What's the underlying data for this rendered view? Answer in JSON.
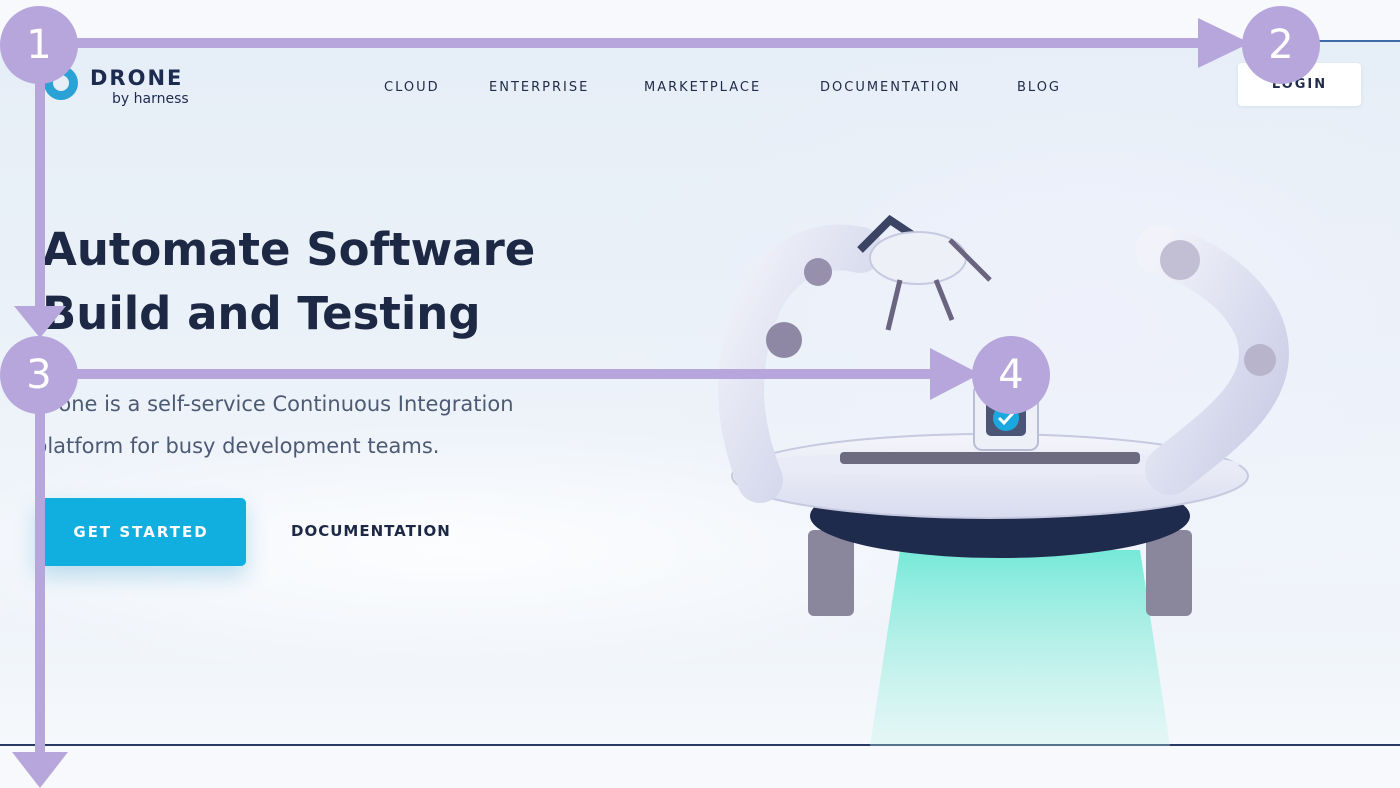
{
  "brand": {
    "name": "DRONE",
    "tagline": "by harness"
  },
  "nav": {
    "items": [
      "CLOUD",
      "ENTERPRISE",
      "MARKETPLACE",
      "DOCUMENTATION",
      "BLOG"
    ],
    "login_label": "LOGIN"
  },
  "hero": {
    "headline_line1": "Automate Software",
    "headline_line2": "Build and Testing",
    "subtext_line1": "Drone is a self-service Continuous Integration",
    "subtext_line2": "platform for busy development teams.",
    "cta_label": "GET STARTED",
    "secondary_label": "DOCUMENTATION"
  },
  "annotations": {
    "markers": [
      "1",
      "2",
      "3",
      "4"
    ]
  },
  "colors": {
    "accent": "#11aee0",
    "text_dark": "#1c2844",
    "overlay": "#b7a6dc",
    "brand_blue": "#2aa2d6"
  },
  "icons": {
    "logo": "drone-logo-icon",
    "illustration": "robot-platform-illustration",
    "check": "checkmark-icon"
  }
}
